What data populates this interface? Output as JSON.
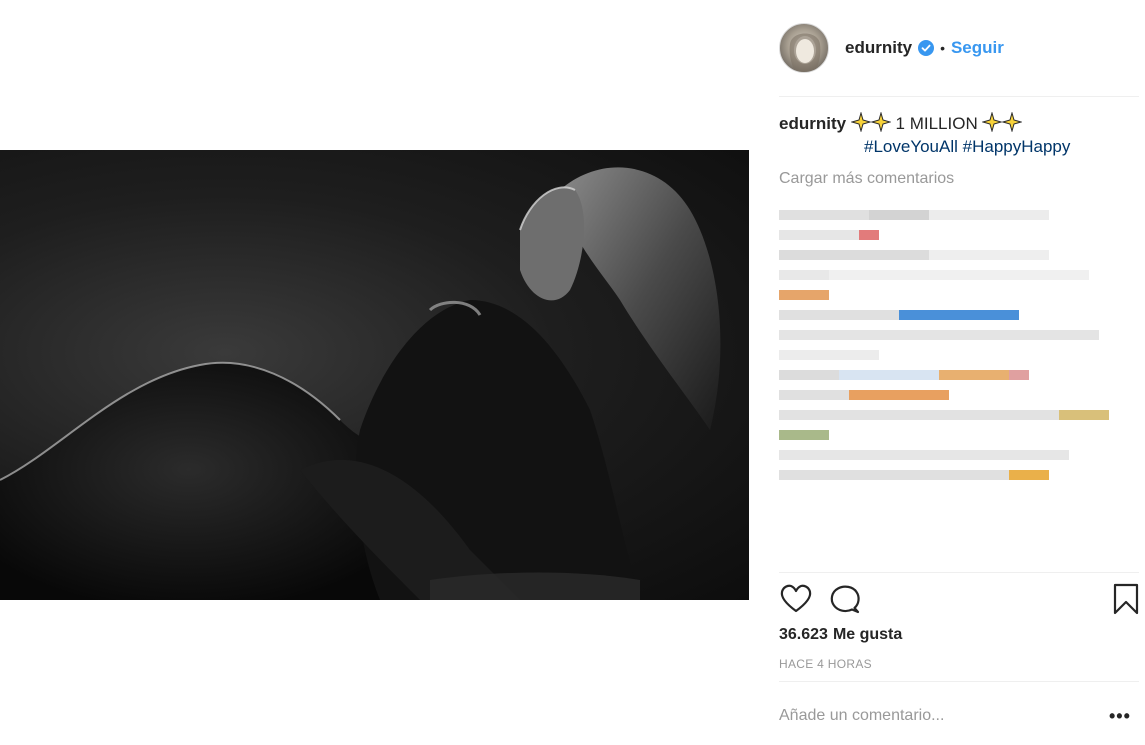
{
  "post": {
    "username": "edurnity",
    "verified": true,
    "separator": "•",
    "follow_label": "Seguir"
  },
  "caption": {
    "username": "edurnity",
    "text": "1 MILLION",
    "hashtags": [
      "#LoveYouAll",
      "#HappyHappy"
    ]
  },
  "comments": {
    "load_more": "Cargar más comentarios"
  },
  "likes": {
    "count": "36.623",
    "suffix": "Me gusta"
  },
  "time": "HACE 4 HORAS",
  "comment_box": {
    "placeholder": "Añade un comentario..."
  },
  "more_options": "•••",
  "icons": {
    "like": "heart-icon",
    "comment": "comment-icon",
    "save": "bookmark-icon",
    "verified": "verified-badge-icon",
    "emoji": "sparkles-icon"
  },
  "colors": {
    "link": "#3897f0",
    "hashtag": "#003569",
    "muted": "#999999",
    "text": "#262626"
  }
}
